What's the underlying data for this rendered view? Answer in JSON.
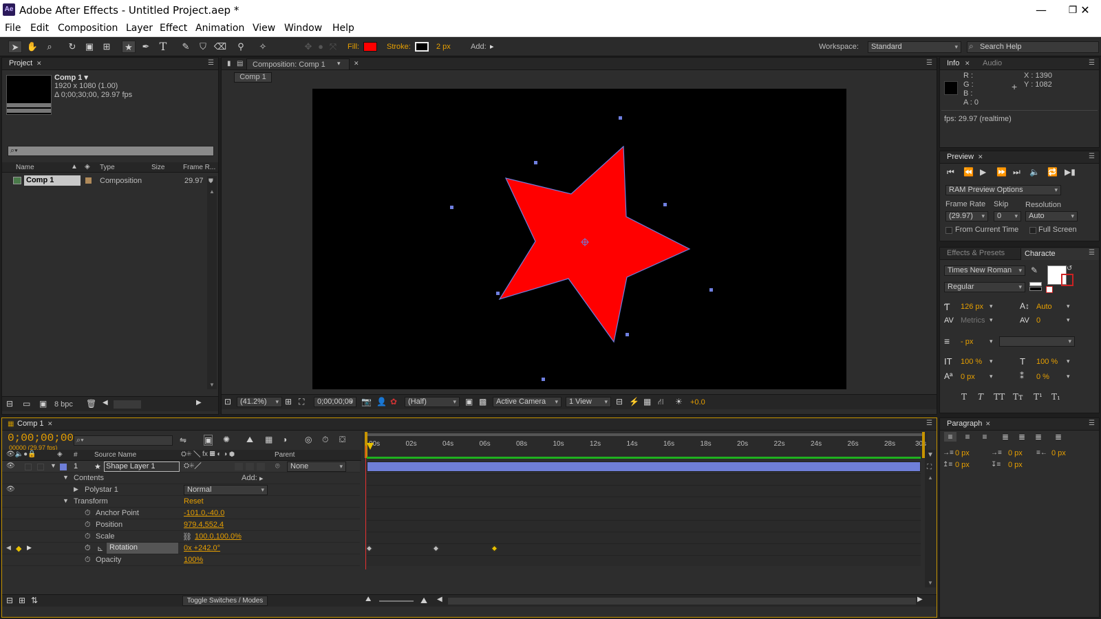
{
  "app": {
    "title": "Adobe After Effects - Untitled Project.aep *",
    "logo": "Ae",
    "window_controls": [
      "minimize-icon",
      "restore-icon",
      "close-icon"
    ]
  },
  "menu": [
    "File",
    "Edit",
    "Composition",
    "Layer",
    "Effect",
    "Animation",
    "View",
    "Window",
    "Help"
  ],
  "toolbar": {
    "tools": [
      "selection-icon",
      "hand-icon",
      "zoom-icon",
      "rotate-icon",
      "camera-orbit-icon",
      "pan-behind-icon",
      "star-shape-icon",
      "pen-icon",
      "type-icon",
      "brush-icon",
      "clone-stamp-icon",
      "eraser-icon",
      "roto-brush-icon",
      "puppet-pin-icon"
    ],
    "fill_label": "Fill:",
    "fill_color": "#ff0000",
    "stroke_label": "Stroke:",
    "stroke_width": "2 px",
    "add_label": "Add:",
    "workspace_label": "Workspace:",
    "workspace_value": "Standard",
    "search_placeholder": "Search Help"
  },
  "project": {
    "tab": "Project",
    "comp_name": "Comp 1 ▾",
    "comp_size": "1920 x 1080 (1.00)",
    "comp_duration": "Δ 0;00;30;00, 29.97 fps",
    "columns": [
      "Name",
      "Type",
      "Size",
      "Frame R..."
    ],
    "items": [
      {
        "name": "Comp 1",
        "type": "Composition",
        "size": "",
        "frame_rate": "29.97"
      }
    ],
    "bpc": "8 bpc"
  },
  "composition": {
    "tab": "Composition: Comp 1",
    "flow_tab": "Comp 1",
    "zoom": "(41.2%)",
    "timecode": "0;00;00;00",
    "resolution": "(Half)",
    "camera": "Active Camera",
    "view": "1 View",
    "exposure": "+0.0",
    "star_fill": "#ff0000",
    "handle_color": "#6f7fe0"
  },
  "info": {
    "tabs": [
      "Info",
      "Audio"
    ],
    "r": "R :",
    "g": "G :",
    "b": "B :",
    "a": "A : 0",
    "x": "X : 1390",
    "y": "Y : 1082",
    "fps": "fps: 29.97 (realtime)"
  },
  "preview": {
    "tab": "Preview",
    "ram_options": "RAM Preview Options",
    "frame_rate_label": "Frame Rate",
    "skip_label": "Skip",
    "resolution_label": "Resolution",
    "frame_rate_value": "(29.97)",
    "skip_value": "0",
    "resolution_value": "Auto",
    "from_current_time": "From Current Time",
    "full_screen": "Full Screen"
  },
  "character": {
    "tabs": [
      "Effects & Presets",
      "Characte"
    ],
    "font": "Times New Roman",
    "style": "Regular",
    "size": "126 px",
    "leading": "Auto",
    "kerning": "Metrics",
    "tracking": "0",
    "stroke_width": "- px",
    "vscale": "100 %",
    "hscale": "100 %",
    "baseline": "0 px",
    "tsume": "0 %",
    "style_buttons": [
      "T",
      "T",
      "TT",
      "Tт",
      "T¹",
      "T₁"
    ]
  },
  "paragraph": {
    "tab": "Paragraph",
    "indent_left": "0 px",
    "indent_first": "0 px",
    "indent_right": "0 px",
    "space_before": "0 px",
    "space_after": "0 px"
  },
  "timeline": {
    "tab": "Comp 1",
    "timecode": "0;00;00;00",
    "frame_info": "00000 (29.97 fps)",
    "col_source": "Source Name",
    "col_num": "#",
    "col_parent": "Parent",
    "ruler": [
      "00s",
      "02s",
      "04s",
      "06s",
      "08s",
      "10s",
      "12s",
      "14s",
      "16s",
      "18s",
      "20s",
      "22s",
      "24s",
      "26s",
      "28s",
      "30s"
    ],
    "layer": {
      "num": "1",
      "name": "Shape Layer 1",
      "parent": "None"
    },
    "contents_label": "Contents",
    "add_label": "Add:",
    "polystar_label": "Polystar 1",
    "blend_mode": "Normal",
    "transform_label": "Transform",
    "reset_label": "Reset",
    "properties": [
      {
        "name": "Anchor Point",
        "value": "-101.0,-40.0"
      },
      {
        "name": "Position",
        "value": "979.4,552.4"
      },
      {
        "name": "Scale",
        "value": "100.0,100.0%"
      },
      {
        "name": "Rotation",
        "value": "0x +242.0°"
      },
      {
        "name": "Opacity",
        "value": "100%"
      }
    ],
    "toggle_label": "Toggle Switches / Modes",
    "keyframes_seconds": [
      0,
      3.6,
      6.8
    ],
    "layer_bar_color": "#6f7fd8",
    "work_area_color": "#1fb11f"
  }
}
